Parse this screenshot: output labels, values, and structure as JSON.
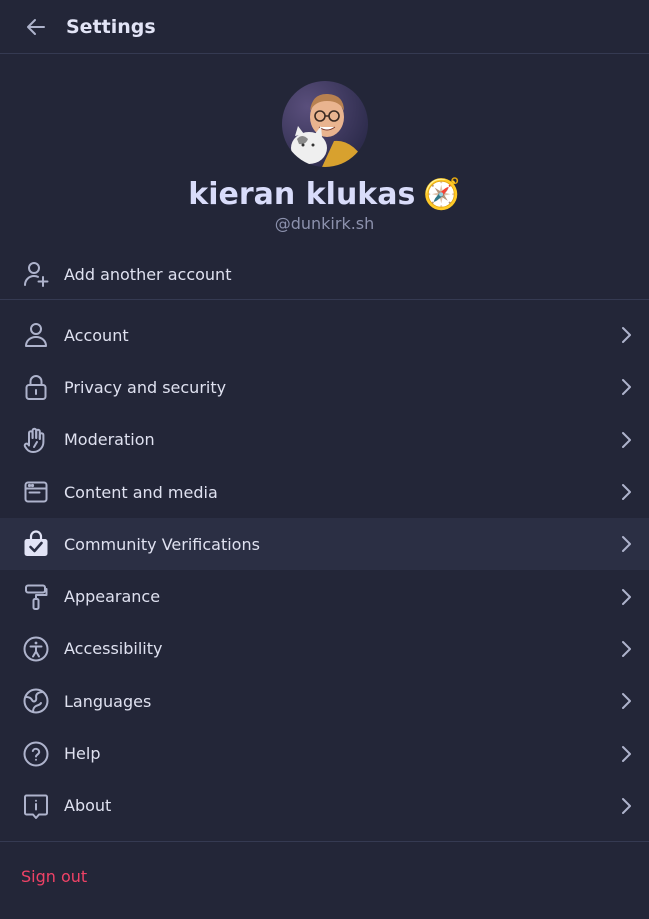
{
  "header": {
    "title": "Settings"
  },
  "profile": {
    "display_name": "kieran klukas",
    "emoji": "🧭",
    "handle": "@dunkirk.sh"
  },
  "add_account_label": "Add another account",
  "menu": [
    {
      "label": "Account",
      "icon": "person-icon"
    },
    {
      "label": "Privacy and security",
      "icon": "lock-icon"
    },
    {
      "label": "Moderation",
      "icon": "raised-hand-icon"
    },
    {
      "label": "Content and media",
      "icon": "window-icon"
    },
    {
      "label": "Community Verifications",
      "icon": "verified-box-icon",
      "active": true
    },
    {
      "label": "Appearance",
      "icon": "paint-roller-icon"
    },
    {
      "label": "Accessibility",
      "icon": "accessibility-icon"
    },
    {
      "label": "Languages",
      "icon": "globe-icon"
    },
    {
      "label": "Help",
      "icon": "question-circle-icon"
    },
    {
      "label": "About",
      "icon": "info-bubble-icon"
    }
  ],
  "sign_out_label": "Sign out",
  "colors": {
    "background": "#232638",
    "active_row": "#2b2f44",
    "sign_out": "#ef4266"
  }
}
